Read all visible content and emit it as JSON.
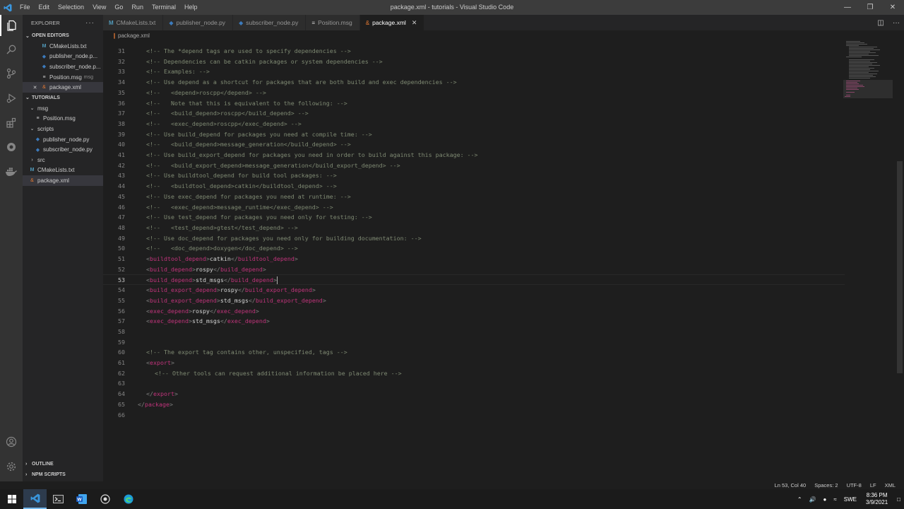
{
  "window": {
    "title": "package.xml - tutorials - Visual Studio Code",
    "menu": [
      "File",
      "Edit",
      "Selection",
      "View",
      "Go",
      "Run",
      "Terminal",
      "Help"
    ]
  },
  "sidebar": {
    "title": "EXPLORER",
    "open_editors_label": "OPEN EDITORS",
    "open_editors": [
      {
        "name": "CMakeLists.txt",
        "icon": "cmake-icon"
      },
      {
        "name": "publisher_node.p...",
        "icon": "python-icon"
      },
      {
        "name": "subscriber_node.p...",
        "icon": "python-icon"
      },
      {
        "name": "Position.msg",
        "desc": "msg",
        "icon": "msg-icon"
      },
      {
        "name": "package.xml",
        "icon": "xml-icon",
        "selected": true
      }
    ],
    "workspace_label": "TUTORIALS",
    "tree": [
      {
        "name": "msg",
        "type": "folder",
        "open": true,
        "indent": 1
      },
      {
        "name": "Position.msg",
        "type": "file",
        "indent": 2
      },
      {
        "name": "scripts",
        "type": "folder",
        "open": true,
        "indent": 1
      },
      {
        "name": "publisher_node.py",
        "type": "py",
        "indent": 2
      },
      {
        "name": "subscriber_node.py",
        "type": "py",
        "indent": 2
      },
      {
        "name": "src",
        "type": "folder",
        "open": false,
        "indent": 1
      },
      {
        "name": "CMakeLists.txt",
        "type": "cmake",
        "indent": 1
      },
      {
        "name": "package.xml",
        "type": "xml",
        "indent": 1,
        "selected": true
      }
    ],
    "outline_label": "OUTLINE",
    "npm_label": "NPM SCRIPTS"
  },
  "tabs": [
    {
      "label": "CMakeLists.txt",
      "icon": "cmake-icon"
    },
    {
      "label": "publisher_node.py",
      "icon": "python-icon"
    },
    {
      "label": "subscriber_node.py",
      "icon": "python-icon"
    },
    {
      "label": "Position.msg",
      "icon": "msg-icon"
    },
    {
      "label": "package.xml",
      "icon": "xml-icon",
      "active": true
    }
  ],
  "breadcrumb": "package.xml",
  "editor": {
    "current_line": 53,
    "lines": [
      {
        "n": 31,
        "indent": "",
        "comment": "<!-- The *depend tags are used to specify dependencies -->"
      },
      {
        "n": 32,
        "indent": "",
        "comment": "<!-- Dependencies can be catkin packages or system dependencies -->"
      },
      {
        "n": 33,
        "indent": "",
        "comment": "<!-- Examples: -->"
      },
      {
        "n": 34,
        "indent": "",
        "comment": "<!-- Use depend as a shortcut for packages that are both build and exec dependencies -->"
      },
      {
        "n": 35,
        "indent": "",
        "comment": "<!--   <depend>roscpp</depend> -->"
      },
      {
        "n": 36,
        "indent": "",
        "comment": "<!--   Note that this is equivalent to the following: -->"
      },
      {
        "n": 37,
        "indent": "",
        "comment": "<!--   <build_depend>roscpp</build_depend> -->"
      },
      {
        "n": 38,
        "indent": "",
        "comment": "<!--   <exec_depend>roscpp</exec_depend> -->"
      },
      {
        "n": 39,
        "indent": "",
        "comment": "<!-- Use build_depend for packages you need at compile time: -->"
      },
      {
        "n": 40,
        "indent": "",
        "comment": "<!--   <build_depend>message_generation</build_depend> -->"
      },
      {
        "n": 41,
        "indent": "",
        "comment": "<!-- Use build_export_depend for packages you need in order to build against this package: -->"
      },
      {
        "n": 42,
        "indent": "",
        "comment": "<!--   <build_export_depend>message_generation</build_export_depend> -->"
      },
      {
        "n": 43,
        "indent": "",
        "comment": "<!-- Use buildtool_depend for build tool packages: -->"
      },
      {
        "n": 44,
        "indent": "",
        "comment": "<!--   <buildtool_depend>catkin</buildtool_depend> -->"
      },
      {
        "n": 45,
        "indent": "",
        "comment": "<!-- Use exec_depend for packages you need at runtime: -->"
      },
      {
        "n": 46,
        "indent": "",
        "comment": "<!--   <exec_depend>message_runtime</exec_depend> -->"
      },
      {
        "n": 47,
        "indent": "",
        "comment": "<!-- Use test_depend for packages you need only for testing: -->"
      },
      {
        "n": 48,
        "indent": "",
        "comment": "<!--   <test_depend>gtest</test_depend> -->"
      },
      {
        "n": 49,
        "indent": "",
        "comment": "<!-- Use doc_depend for packages you need only for building documentation: -->"
      },
      {
        "n": 50,
        "indent": "",
        "comment": "<!--   <doc_depend>doxygen</doc_depend> -->"
      },
      {
        "n": 51,
        "indent": "",
        "tag": "buildtool_depend",
        "text": "catkin"
      },
      {
        "n": 52,
        "indent": "",
        "tag": "build_depend",
        "text": "rospy"
      },
      {
        "n": 53,
        "indent": "",
        "tag": "build_depend",
        "text": "std_msgs"
      },
      {
        "n": 54,
        "indent": "",
        "tag": "build_export_depend",
        "text": "rospy"
      },
      {
        "n": 55,
        "indent": "",
        "tag": "build_export_depend",
        "text": "std_msgs"
      },
      {
        "n": 56,
        "indent": "",
        "tag": "exec_depend",
        "text": "rospy"
      },
      {
        "n": 57,
        "indent": "",
        "tag": "exec_depend",
        "text": "std_msgs"
      },
      {
        "n": 58,
        "indent": ""
      },
      {
        "n": 59,
        "indent": ""
      },
      {
        "n": 60,
        "indent": "",
        "comment": "<!-- The export tag contains other, unspecified, tags -->"
      },
      {
        "n": 61,
        "indent": "",
        "open": "export"
      },
      {
        "n": 62,
        "indent": "  ",
        "comment": "<!-- Other tools can request additional information be placed here -->"
      },
      {
        "n": 63,
        "indent": ""
      },
      {
        "n": 64,
        "indent": "",
        "close": "export"
      },
      {
        "n": 65,
        "indent": "-1",
        "close": "package"
      },
      {
        "n": 66,
        "indent": ""
      }
    ]
  },
  "statusbar": {
    "position": "Ln 53, Col 40",
    "spaces": "Spaces: 2",
    "encoding": "UTF-8",
    "eol": "LF",
    "language": "XML"
  },
  "taskbar": {
    "lang": "SWE",
    "time": "8:36 PM",
    "date": "3/9/2021"
  },
  "colors": {
    "accent": "#007acc",
    "tag": "#c0347b",
    "comment": "#7f8a73",
    "background": "#1e1e1e"
  }
}
